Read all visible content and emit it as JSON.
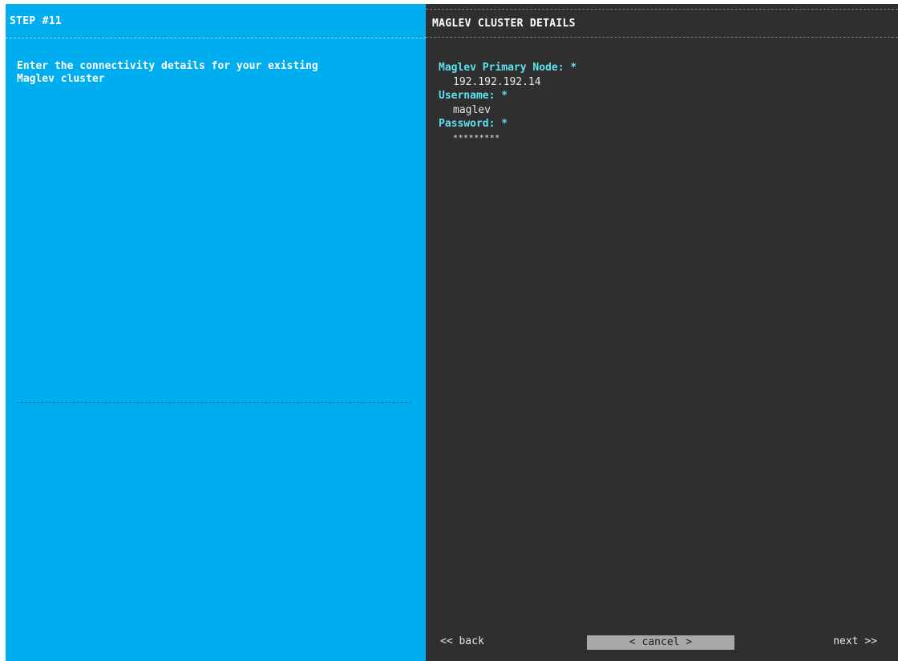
{
  "left_panel": {
    "title": "STEP #11",
    "description": "Enter the connectivity details for your existing\nMaglev cluster"
  },
  "right_panel": {
    "title": "MAGLEV CLUSTER DETAILS",
    "fields": [
      {
        "label": "Maglev Primary Node: *",
        "value": "192.192.192.14"
      },
      {
        "label": "Username: *",
        "value": "maglev"
      },
      {
        "label": "Password: *",
        "value": "*********"
      }
    ]
  },
  "footer": {
    "back_label": "<< back",
    "cancel_label": "< cancel >",
    "next_label": "next >>"
  },
  "colors": {
    "left_bg": "#00adef",
    "right_bg": "#2f2f2f",
    "label_color": "#5fe3ef",
    "cancel_bg": "#a9a9a9"
  }
}
